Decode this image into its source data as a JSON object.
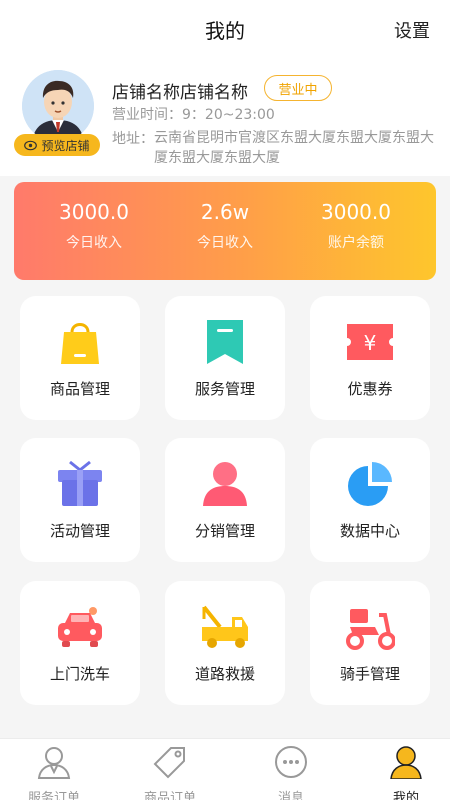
{
  "header": {
    "title": "我的",
    "settings_label": "设置"
  },
  "profile": {
    "store_name": "店铺名称店铺名称",
    "status": "营业中",
    "preview_label": "预览店铺",
    "hours": "营业时间：9：20~23:00",
    "address_label": "地址：",
    "address": "云南省昆明市官渡区东盟大厦东盟大厦东盟大厦东盟大厦东盟大厦"
  },
  "stats": [
    {
      "value": "3000.0",
      "label": "今日收入"
    },
    {
      "value": "2.6w",
      "label": "今日收入"
    },
    {
      "value": "3000.0",
      "label": "账户余额"
    }
  ],
  "grid": [
    {
      "label": "商品管理",
      "icon": "shopping-bag-icon"
    },
    {
      "label": "服务管理",
      "icon": "bookmark-icon"
    },
    {
      "label": "优惠券",
      "icon": "coupon-icon"
    },
    {
      "label": "活动管理",
      "icon": "gift-icon"
    },
    {
      "label": "分销管理",
      "icon": "person-icon"
    },
    {
      "label": "数据中心",
      "icon": "pie-chart-icon"
    },
    {
      "label": "上门洗车",
      "icon": "car-icon"
    },
    {
      "label": "道路救援",
      "icon": "tow-truck-icon"
    },
    {
      "label": "骑手管理",
      "icon": "scooter-icon"
    }
  ],
  "tabbar": [
    {
      "label": "服务订单",
      "icon": "person-outline-icon"
    },
    {
      "label": "商品订单",
      "icon": "tag-icon"
    },
    {
      "label": "消息",
      "icon": "chat-bubble-icon"
    },
    {
      "label": "我的",
      "icon": "person-filled-icon"
    }
  ],
  "colors": {
    "accent": "#f6b71d",
    "gradient_start": "#ff7a6b",
    "gradient_end": "#fec62c",
    "muted_text": "#999999"
  }
}
